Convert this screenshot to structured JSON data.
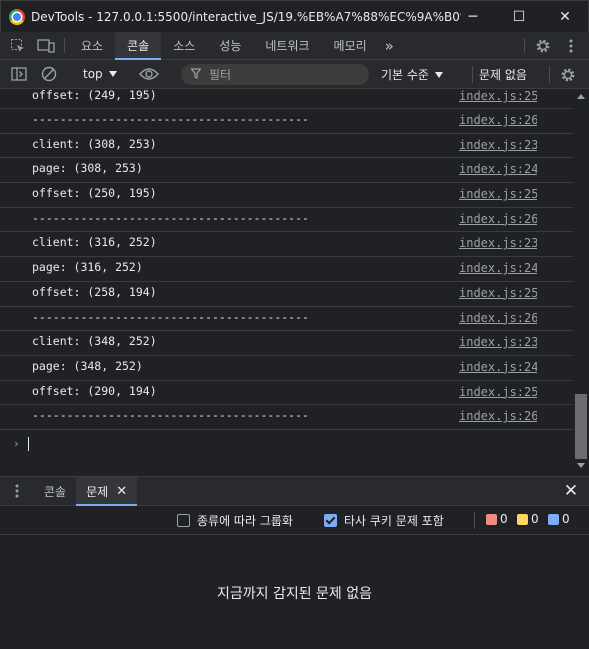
{
  "window": {
    "title": "DevTools - 127.0.0.1:5500/interactive_JS/19.%EB%A7%88%EC%9A%B0%EC%...",
    "minimize": "─",
    "maximize": "☐",
    "close": "✕"
  },
  "main_tabs": {
    "items": [
      "요소",
      "콘솔",
      "소스",
      "성능",
      "네트워크",
      "메모리"
    ],
    "active": "콘솔",
    "more": "»"
  },
  "console_toolbar": {
    "context": "top",
    "filter_placeholder": "필터",
    "levels": "기본 수준",
    "issues": "문제 없음"
  },
  "console": {
    "rows": [
      {
        "msg": "offset: (249, 195)",
        "src": "index.js:25"
      },
      {
        "msg": "----------------------------------------",
        "src": "index.js:26"
      },
      {
        "msg": "client: (308, 253)",
        "src": "index.js:23"
      },
      {
        "msg": "page: (308, 253)",
        "src": "index.js:24"
      },
      {
        "msg": "offset: (250, 195)",
        "src": "index.js:25"
      },
      {
        "msg": "----------------------------------------",
        "src": "index.js:26"
      },
      {
        "msg": "client: (316, 252)",
        "src": "index.js:23"
      },
      {
        "msg": "page: (316, 252)",
        "src": "index.js:24"
      },
      {
        "msg": "offset: (258, 194)",
        "src": "index.js:25"
      },
      {
        "msg": "----------------------------------------",
        "src": "index.js:26"
      },
      {
        "msg": "client: (348, 252)",
        "src": "index.js:23"
      },
      {
        "msg": "page: (348, 252)",
        "src": "index.js:24"
      },
      {
        "msg": "offset: (290, 194)",
        "src": "index.js:25"
      },
      {
        "msg": "----------------------------------------",
        "src": "index.js:26"
      }
    ],
    "prompt": "›"
  },
  "drawer": {
    "tabs": [
      "콘솔",
      "문제"
    ],
    "active": "문제",
    "close_tab": "✕",
    "close_drawer": "✕"
  },
  "issues": {
    "group_by_kind": "종류에 따라 그룹화",
    "group_by_kind_checked": false,
    "include_third_party": "타사 쿠키 문제 포함",
    "include_third_party_checked": true,
    "counts": {
      "errors": "0",
      "warnings": "0",
      "info": "0"
    },
    "empty_message": "지금까지 감지된 문제 없음"
  },
  "colors": {
    "accent": "#7cacf8",
    "error": "#f28b82",
    "warning": "#fdd663",
    "info": "#7cacf8"
  }
}
